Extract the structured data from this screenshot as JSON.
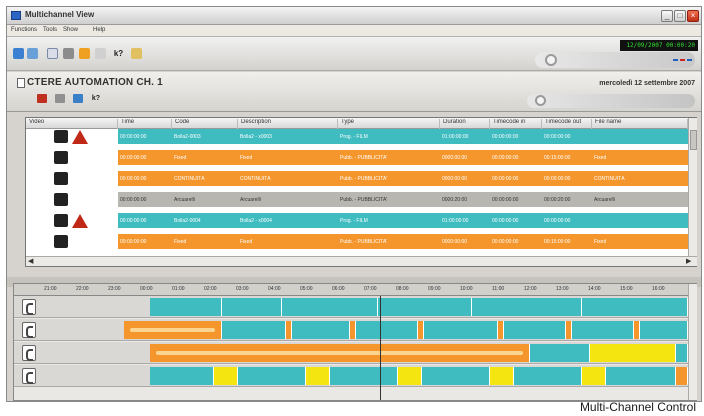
{
  "window": {
    "title": "Multichannel View"
  },
  "menu": {
    "items": [
      "Functions",
      "Tools",
      "Show",
      "Help"
    ]
  },
  "toolbar": {
    "clock": "12/09/2007 00:00:20"
  },
  "channel": {
    "name": "CTERE AUTOMATION CH. 1",
    "date": "mercoledì 12 settembre 2007"
  },
  "grid": {
    "columns": [
      "Video",
      "Time",
      "Code",
      "Description",
      "Type",
      "Duration",
      "Timecode in",
      "Timecode out",
      "File name"
    ],
    "rows": [
      {
        "color": "teal",
        "time": "00:00:00:00",
        "code": "Bolla2-0003",
        "desc": "Bolla2 - x0003",
        "type": "Prog. - FILM",
        "duration": "01:00:00:00",
        "tcin": "00:00:00:00",
        "tcout": "00:00:00:00",
        "file": ""
      },
      {
        "color": "orange",
        "time": "00:00:00:00",
        "code": "Fixed",
        "desc": "Fixed",
        "type": "Pubb. - PUBBLICITA'",
        "duration": "0000:00:00",
        "tcin": "00:00:00:00",
        "tcout": "00:15:00:00",
        "file": "Fixed"
      },
      {
        "color": "orange",
        "time": "00:00:00:00",
        "code": "CONTINUITÀ",
        "desc": "CONTINUITÀ",
        "type": "Pubb. - PUBBLICITA'",
        "duration": "0000:00:00",
        "tcin": "00:00:00:00",
        "tcout": "00:00:00:00",
        "file": "CONTINUITÀ"
      },
      {
        "color": "grey",
        "time": "00:00:00:00",
        "code": "Arcuarelli",
        "desc": "Arcuarelli",
        "type": "Pubb. - PUBBLICITA'",
        "duration": "0000:20:00",
        "tcin": "00:00:00:00",
        "tcout": "00:00:20:00",
        "file": "Arcuarelli"
      },
      {
        "color": "teal",
        "time": "00:00:00:00",
        "code": "Bolla2-0004",
        "desc": "Bolla2 - x0004",
        "type": "Prog. - FILM",
        "duration": "01:00:00:00",
        "tcin": "00:00:00:00",
        "tcout": "00:00:00:00",
        "file": ""
      },
      {
        "color": "orange",
        "time": "00:00:00:00",
        "code": "Fixed",
        "desc": "Fixed",
        "type": "Pubb. - PUBBLICITA'",
        "duration": "0000:00:00",
        "tcin": "00:00:00:00",
        "tcout": "00:15:00:00",
        "file": "Fixed"
      }
    ]
  },
  "timeline": {
    "ticks": [
      "21:00",
      "22:00",
      "23:00",
      "00:00",
      "01:00",
      "02:00",
      "03:00",
      "04:00",
      "05:00",
      "06:00",
      "07:00",
      "08:00",
      "09:00",
      "10:00",
      "11:00",
      "12:00",
      "13:00",
      "14:00",
      "15:00",
      "16:00"
    ]
  },
  "caption": "Multi-Channel Control"
}
